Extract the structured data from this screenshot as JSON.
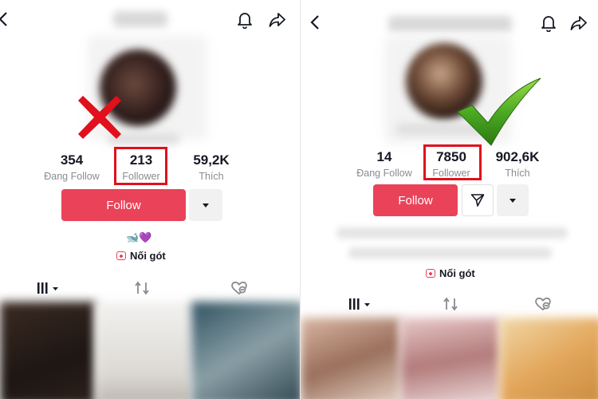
{
  "left": {
    "stats": [
      {
        "value": "354",
        "label": "Đang Follow"
      },
      {
        "value": "213",
        "label": "Follower"
      },
      {
        "value": "59,2K",
        "label": "Thích"
      }
    ],
    "follow_label": "Follow",
    "bio_emoji": "🐋💜",
    "noigot_label": "Nối gót",
    "verdict_icon": "red-x-mark"
  },
  "right": {
    "stats": [
      {
        "value": "14",
        "label": "Đang Follow"
      },
      {
        "value": "7850",
        "label": "Follower"
      },
      {
        "value": "902,6K",
        "label": "Thích"
      }
    ],
    "follow_label": "Follow",
    "noigot_label": "Nối gót",
    "verdict_icon": "green-check-mark"
  },
  "colors": {
    "accent": "#ea4359",
    "highlight_box": "#e0101c",
    "cross": "#e0101c",
    "check": "#3a9a1e"
  },
  "icons": [
    "back-chevron-icon",
    "bell-icon",
    "share-arrow-icon",
    "send-icon",
    "caret-down-icon",
    "grid-icon",
    "repost-icon",
    "liked-heart-icon"
  ]
}
